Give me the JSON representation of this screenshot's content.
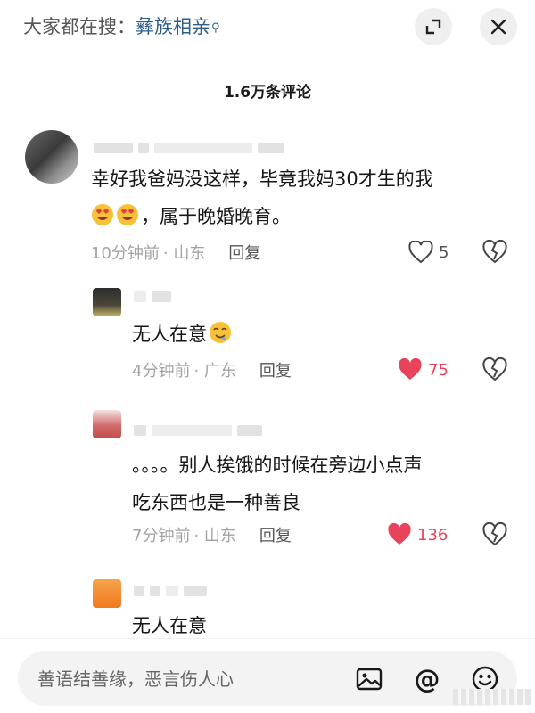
{
  "header": {
    "search_prefix": "大家都在搜：",
    "search_term": "彝族相亲",
    "expand_icon": "expand-icon",
    "close_icon": "close-icon"
  },
  "comments_title": "1.6万条评论",
  "comments": [
    {
      "text_line1": "幸好我爸妈没这样，毕竟我妈30才生的我",
      "text_line2": "，属于晚婚晚育。",
      "emoji": "heart-eyes-emoji",
      "time": "10分钟前",
      "location": "· 山东",
      "reply": "回复",
      "likes": "5",
      "liked": false
    },
    {
      "text": "无人在意",
      "emoji": "drooling-face-emoji",
      "time": "4分钟前",
      "location": "· 广东",
      "reply": "回复",
      "likes": "75",
      "liked": true
    },
    {
      "text_line1": "。。。。别人挨饿的时候在旁边小点声",
      "text_line2": "吃东西也是一种善良",
      "time": "7分钟前",
      "location": "· 山东",
      "reply": "回复",
      "likes": "136",
      "liked": true
    },
    {
      "text": "无人在意"
    }
  ],
  "composer": {
    "placeholder": "善语结善缘，恶言伤人心",
    "image_icon": "image-icon",
    "mention_label": "@",
    "emoji_icon": "emoji-icon"
  },
  "colors": {
    "like_active": "#e8435a",
    "search_term": "#2f5d8a",
    "meta_text": "#a3a3a3"
  }
}
